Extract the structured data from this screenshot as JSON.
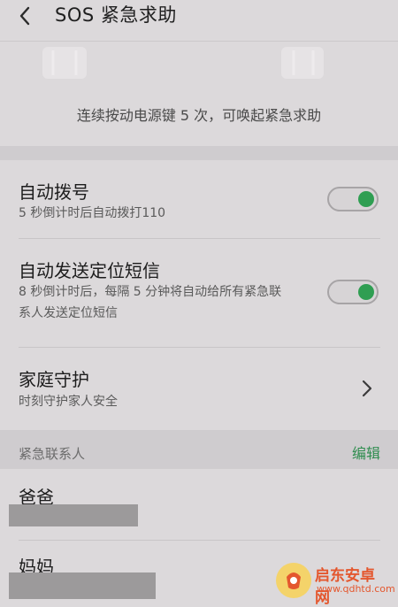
{
  "header": {
    "title": "SOS 紧急求助"
  },
  "hero": {
    "hint": "连续按动电源键 5 次，可唤起紧急求助"
  },
  "settings": [
    {
      "title": "自动拨号",
      "subtitle": "5 秒倒计时后自动拨打110",
      "control": "switch",
      "enabled": true
    },
    {
      "title": "自动发送定位短信",
      "subtitle": "8 秒倒计时后，每隔 5 分钟将自动给所有紧急联系人发送定位短信",
      "subtitle_lines": [
        "8 秒倒计时后，每隔 5 分钟将自动给所有紧急联",
        "系人发送定位短信"
      ],
      "control": "switch",
      "enabled": true
    },
    {
      "title": "家庭守护",
      "subtitle": "时刻守护家人安全",
      "control": "chevron"
    }
  ],
  "contacts_section": {
    "label": "紧急联系人",
    "edit_label": "编辑",
    "contacts": [
      {
        "name": "爸爸"
      },
      {
        "name": "妈妈"
      }
    ]
  },
  "watermark": {
    "title": "启东安卓网",
    "url": "www.qdhtd.com"
  },
  "colors": {
    "accent": "#2f9e52",
    "background": "#dcd9db",
    "section": "#cfcccf"
  }
}
